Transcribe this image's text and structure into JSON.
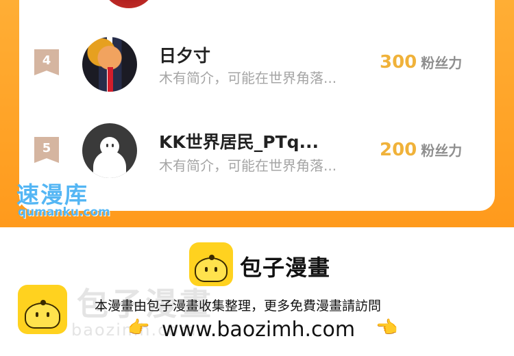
{
  "rank_list": [
    {
      "rank": "4",
      "name": "日夕寸",
      "bio": "木有简介，可能在世界角落...",
      "score": "300",
      "unit": "粉丝力",
      "avatar": "photo-avatar"
    },
    {
      "rank": "5",
      "name": "KK世界居民_PTq...",
      "bio": "木有简介，可能在世界角落...",
      "score": "200",
      "unit": "粉丝力",
      "avatar": "default-avatar"
    }
  ],
  "watermark": {
    "site_name": "速漫库",
    "site_url": "qumanku.com"
  },
  "footer": {
    "brand_title": "包子漫畫",
    "brand_ghost": "包子漫畫",
    "brand_ghost_url": "baozimh.com",
    "notice": "本漫畫由包子漫畫收集整理，更多免費漫畫請訪問",
    "url": "www.baozimh.com",
    "hand_left_icon": "👉",
    "hand_right_icon": "👈"
  },
  "colors": {
    "accent": "#ff9f22",
    "score": "#f0b23a",
    "badge": "#d5b5a0",
    "watermark": "#54b6f4"
  }
}
